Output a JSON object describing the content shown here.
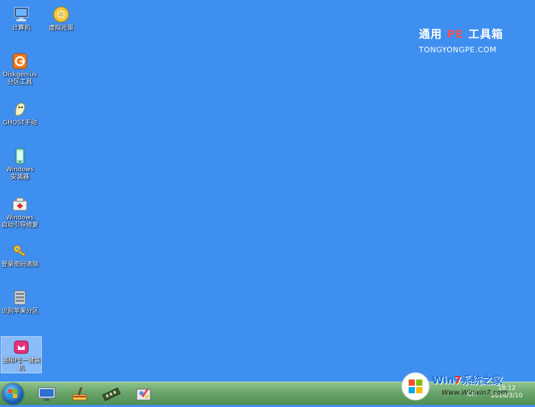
{
  "desktop": {
    "icons": [
      {
        "label": "计算机",
        "icon": "computer-icon"
      },
      {
        "label": "虚拟光驱",
        "icon": "virtual-drive-icon"
      },
      {
        "label": "Diskgenius\n分区工具",
        "icon": "diskgenius-icon"
      },
      {
        "label": "GHOST手动",
        "icon": "ghost-icon"
      },
      {
        "label": "Windows\n安装器",
        "icon": "windows-installer-icon"
      },
      {
        "label": "Windows\n启动引导修复",
        "icon": "boot-repair-icon"
      },
      {
        "label": "登录密码清除",
        "icon": "key-icon"
      },
      {
        "label": "识别苹果分区",
        "icon": "apple-partition-icon"
      },
      {
        "label": "通用PE一键装机",
        "icon": "one-click-install-icon"
      }
    ]
  },
  "brand": {
    "title_prefix": "通用",
    "title_pe": "PE",
    "title_suffix": "工具箱",
    "url": "TONGYONGPE.COM"
  },
  "taskbar": {
    "buttons": [
      "start-orb",
      "monitor-icon",
      "broom-icon",
      "memory-icon",
      "tools-icon"
    ],
    "tray": {
      "ch": "CH",
      "time": "18:12",
      "date": "2016/3/10"
    }
  },
  "watermark": {
    "site_a": "Win",
    "site_b": "7",
    "site_c": "系统之家",
    "url": "Www.Winwin7.com"
  },
  "colors": {
    "desktop": "#3f8ff0",
    "taskbar": "#6ba56b",
    "brand_pe": "#f0505a"
  }
}
